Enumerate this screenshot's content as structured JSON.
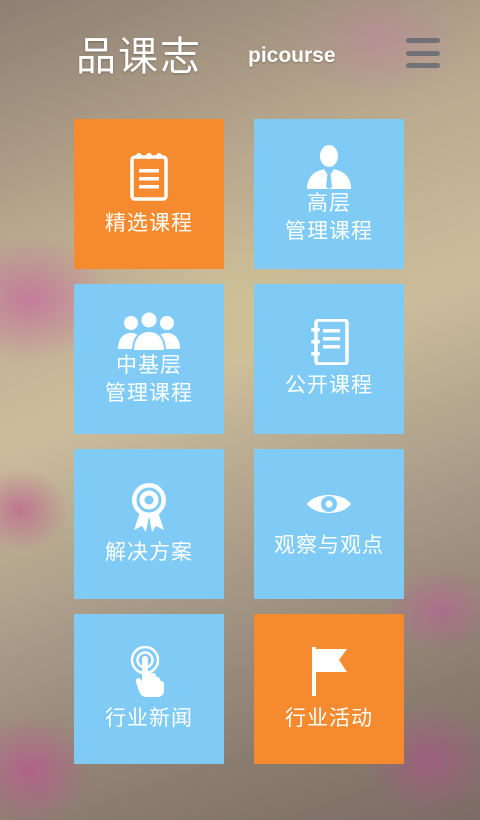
{
  "header": {
    "logo_cn": "品课志",
    "logo_en": "picourse",
    "menu_icon": "hamburger-icon"
  },
  "tiles": [
    {
      "label": "精选课程",
      "icon": "notepad-icon",
      "color": "#f58a2e"
    },
    {
      "label_line1": "高层",
      "label_line2": "管理课程",
      "icon": "executive-person-icon",
      "color": "#7fcbf5"
    },
    {
      "label_line1": "中基层",
      "label_line2": "管理课程",
      "icon": "group-people-icon",
      "color": "#7fcbf5"
    },
    {
      "label": "公开课程",
      "icon": "notebook-icon",
      "color": "#7fcbf5"
    },
    {
      "label": "解决方案",
      "icon": "target-badge-icon",
      "color": "#7fcbf5"
    },
    {
      "label": "观察与观点",
      "icon": "eye-icon",
      "color": "#7fcbf5"
    },
    {
      "label": "行业新闻",
      "icon": "touch-finger-icon",
      "color": "#7fcbf5"
    },
    {
      "label": "行业活动",
      "icon": "flag-icon",
      "color": "#f58a2e"
    }
  ]
}
